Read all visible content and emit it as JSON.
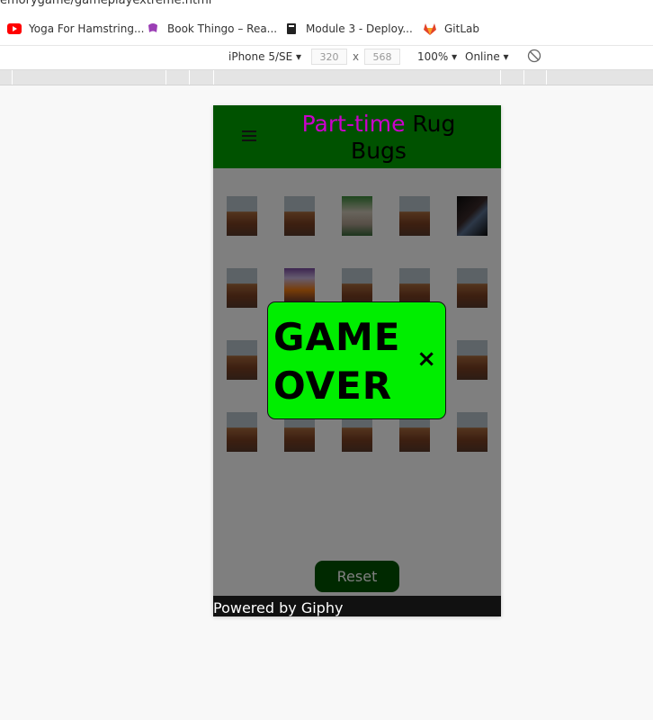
{
  "browser": {
    "url_fragment": "emorygame/gameplayextreme.html",
    "bookmarks": [
      {
        "label": "Yoga For Hamstring...",
        "icon": "youtube-icon"
      },
      {
        "label": "Book Thingo – Rea...",
        "icon": "bookthingo-icon"
      },
      {
        "label": "Module 3 - Deploy...",
        "icon": "book-icon"
      },
      {
        "label": "GitLab",
        "icon": "gitlab-icon"
      }
    ]
  },
  "devtools": {
    "device": "iPhone 5/SE",
    "width": "320",
    "height": "568",
    "times": "x",
    "zoom": "100%",
    "network": "Online"
  },
  "app": {
    "title_pink": "Part-time",
    "title_black": "Rug Bugs",
    "reset_label": "Reset",
    "footer": "Powered by Giphy",
    "modal_line1": "GAME",
    "modal_line2": "OVER",
    "close_glyph": "×"
  },
  "colors": {
    "header_green": "#005200",
    "title_pink": "#cc00cc",
    "modal_green": "#00ee00",
    "footer_black": "#111111"
  }
}
